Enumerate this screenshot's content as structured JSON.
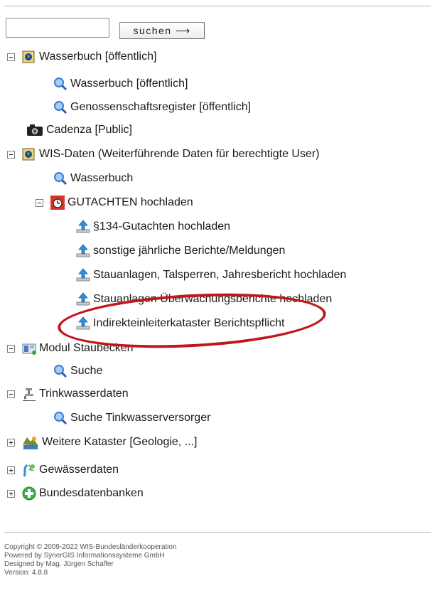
{
  "search": {
    "placeholder": "",
    "button_label": "suchen  ⟶"
  },
  "tree": {
    "wasserbuch": {
      "label": "Wasserbuch [öffentlich]",
      "children": [
        "Wasserbuch [öffentlich]",
        "Genossenschaftsregister [öffentlich]"
      ]
    },
    "cadenza": {
      "label": "Cadenza [Public]"
    },
    "wis_daten": {
      "label": "WIS-Daten (Weiterführende Daten für berechtigte User)",
      "wasserbuch": "Wasserbuch",
      "gutachten": {
        "label": "GUTACHTEN hochladen",
        "children": [
          "§134-Gutachten hochladen",
          "sonstige jährliche Berichte/Meldungen",
          "Stauanlagen, Talsperren, Jahresbericht hochladen",
          "Stauanlagen Überwachungsberichte hochladen",
          "Indirekteinleiterkataster Berichtspflicht"
        ]
      }
    },
    "modul": {
      "label": "Modul Staubecken",
      "children": [
        "Suche"
      ]
    },
    "trinkwasser": {
      "label": "Trinkwasserdaten",
      "children": [
        "Suche Tinkwasserversorger"
      ]
    },
    "weitere": {
      "label": "Weitere Kataster [Geologie, ...]"
    },
    "gewaesser": {
      "label": "Gewässerdaten"
    },
    "bundes": {
      "label": "Bundesdatenbanken"
    }
  },
  "footer": {
    "line1": "Copyright © 2009-2022 WIS-Bundesländerkooperation",
    "line2": "Powered by SynerGIS Informationssysteme GmbH",
    "line3": "Designed by Mag. Jürgen Schaffer",
    "line4": "Version: 4.8.8"
  },
  "colors": {
    "annotation": "#c0161e",
    "search_icon": "#3a7bd5",
    "upload_arrow": "#2f8fd8"
  }
}
